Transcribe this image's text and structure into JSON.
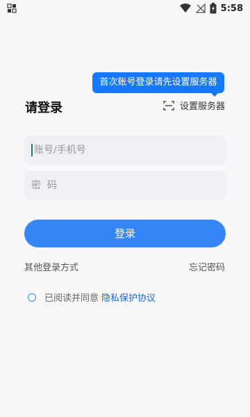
{
  "status_bar": {
    "time": "5:58",
    "left_icon": "notification-app-icon",
    "icons": [
      "wifi-icon",
      "no-signal-icon",
      "battery-icon"
    ]
  },
  "tooltip": {
    "text": "首次账号登录请先设置服务器"
  },
  "title": "请登录",
  "server": {
    "label": "设置服务器",
    "icon": "scan-frame-icon"
  },
  "account": {
    "placeholder": "账号/手机号"
  },
  "password": {
    "placeholder": "密  码"
  },
  "login_button": "登录",
  "other_login": "其他登录方式",
  "forgot_password": "忘记密码",
  "agreement": {
    "text": "已阅读并同意",
    "link": "隐私保护协议"
  },
  "colors": {
    "primary": "#3585f5",
    "tooltip": "#1677ff",
    "link": "#1f66d1",
    "background": "#f8f8fb",
    "field": "#eef0f6"
  }
}
